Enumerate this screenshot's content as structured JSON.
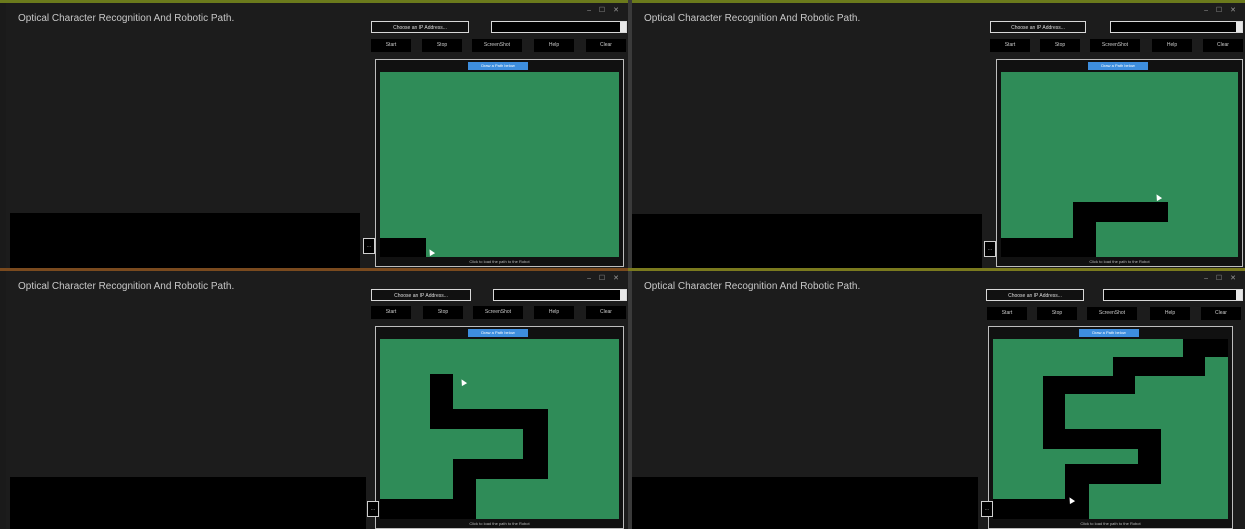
{
  "app": {
    "title": "Optical Character Recognition And Robotic Path.",
    "window_controls": "– ☐ ✕",
    "ip_button": "Choose an IP Address...",
    "toolbar": [
      "Start",
      "Stop",
      "ScreenShot",
      "Help",
      "Clear"
    ],
    "canvas_label": "Draw a Path below",
    "status_text": "Click to load the path to the Robot",
    "small_button": "..."
  },
  "colors": {
    "grid": "#2f8c58",
    "path": "#000000",
    "label": "#3e8ede"
  },
  "icons": [
    "minimize-icon",
    "maximize-icon",
    "close-icon",
    "dropdown-arrow-icon",
    "cursor-icon"
  ]
}
